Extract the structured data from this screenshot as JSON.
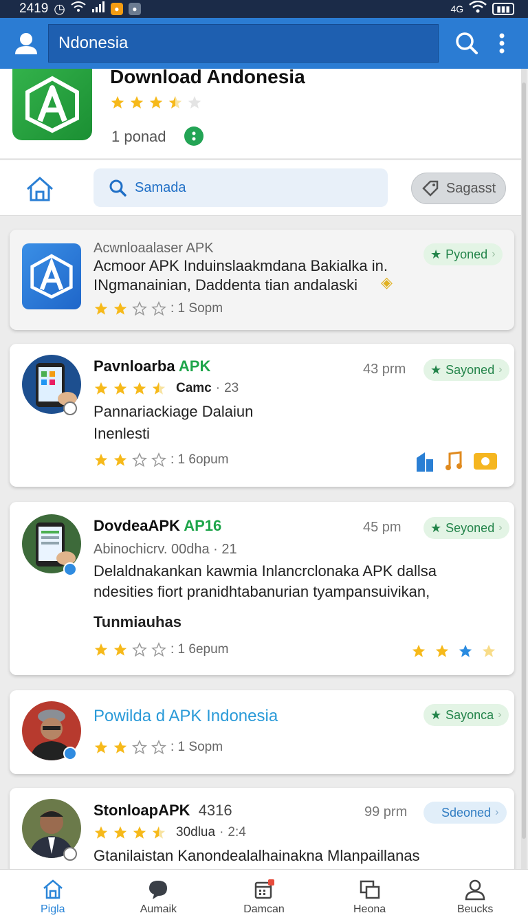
{
  "status_bar": {
    "time": "2419",
    "network": "4G"
  },
  "app_bar": {
    "search_value": "Ndonesia"
  },
  "header": {
    "title": "Download Andonesia",
    "subtitle": "1 ponad",
    "rating": 3.5
  },
  "filter": {
    "search_value": "Samada",
    "suggest_label": "Sagasst"
  },
  "cards": [
    {
      "line1": "Acwnloaalaser APK",
      "line2": "Acmoor APK Induinslaakmdana Bakialka in.",
      "line3": "INgmanainian, Daddenta tian andalaski",
      "rating_text": ": 1 Sopm",
      "rating": 2,
      "chip": "Pyoned"
    },
    {
      "title": "Pavnloarba",
      "title_accent": "APK",
      "time": "43 prm",
      "chip": "Sayoned",
      "meta_label": "Camc",
      "meta_count": "23",
      "desc1": "Pannariackiage Dalaiun",
      "desc2": "Inenlesti",
      "rating_text": ": 1 6opum",
      "rating": 2
    },
    {
      "title": "DovdeaAPK",
      "title_accent": "AP16",
      "time": "45 pm",
      "chip": "Seyoned",
      "subline": "Abinochicrv. 00dha · 21",
      "desc1": "Delaldnakankan kawmia Inlancrclonaka APK dallsa",
      "desc2": "ndesities fiort pranidhtabanurian tyampansuivikan,",
      "desc3": "Tunmiauhas",
      "rating_text": ": 1 6epum",
      "rating": 2
    },
    {
      "title": "Powilda d APK Indonesia",
      "chip": "Sayonca",
      "rating_text": ": 1 Sopm",
      "rating": 2
    },
    {
      "title": "StonloapAPK",
      "title_num": "4316",
      "time": "99 prm",
      "chip": "Sdeoned",
      "meta_label": "30dlua",
      "meta_count": "2:4",
      "desc1": "Gtanilaistan Kanondealalhainakna Mlanpaillanas",
      "rating": 3.5
    }
  ],
  "bottom_nav": [
    {
      "label": "Pigla",
      "icon": "home-icon",
      "active": true
    },
    {
      "label": "Aumaik",
      "icon": "chat-icon",
      "active": false
    },
    {
      "label": "Damcan",
      "icon": "calendar-icon",
      "active": false
    },
    {
      "label": "Heona",
      "icon": "windows-icon",
      "active": false
    },
    {
      "label": "Beucks",
      "icon": "person-icon",
      "active": false
    }
  ],
  "colors": {
    "status_bar": "#1b2b48",
    "app_bar": "#2b7cd3",
    "accent_green": "#1ea54a",
    "star": "#f6b91a",
    "active_nav": "#2a85d8"
  }
}
